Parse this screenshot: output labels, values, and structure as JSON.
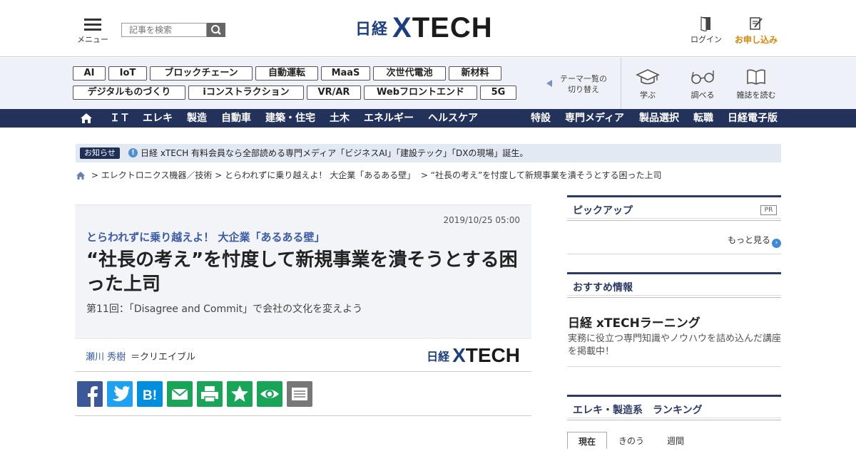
{
  "header": {
    "menu_label": "メニュー",
    "search_placeholder": "記事を検索",
    "logo_nikkei": "日経",
    "logo_x": "X",
    "logo_tech": "TECH",
    "login_label": "ログイン",
    "subscribe_label": "お申し込み"
  },
  "themes": {
    "tags": [
      "AI",
      "IoT",
      "ブロックチェーン",
      "自動運転",
      "MaaS",
      "次世代電池",
      "新材料",
      "デジタルものづくり",
      "iコンストラクション",
      "VR/AR",
      "Webフロントエンド",
      "5G"
    ],
    "switch_line1": "テーマ一覧の",
    "switch_line2": "切り替え",
    "learn_label": "学ぶ",
    "research_label": "調べる",
    "magazine_label": "雑誌を読む"
  },
  "nav": {
    "left": [
      "ＩＴ",
      "エレキ",
      "製造",
      "自動車",
      "建築・住宅",
      "土木",
      "エネルギー",
      "ヘルスケア"
    ],
    "right": [
      "特設",
      "専門メディア",
      "製品選択",
      "転職",
      "日経電子版"
    ]
  },
  "notice": {
    "badge": "お知らせ",
    "text": "日経 xTECH 有料会員なら全部読める専門メディア「ビジネスAI」「建設テック」「DXの現場」誕生。"
  },
  "breadcrumb": [
    "エレクトロニクス機器／技術",
    "とらわれずに乗り越えよ！ 大企業「あるある壁」",
    "“社長の考え”を忖度して新規事業を潰そうとする困った上司"
  ],
  "article": {
    "date": "2019/10/25 05:00",
    "series": "とらわれずに乗り越えよ！ 大企業「あるある壁」",
    "title": "“社長の考え”を忖度して新規事業を潰そうとする困った上司",
    "subtitle": "第11回：「Disagree and Commit」で会社の文化を変えよう",
    "author": "瀬川 秀樹",
    "org": "＝クリエイブル"
  },
  "share": {
    "colors": [
      "#3b5998",
      "#1da1f2",
      "#008fde",
      "#18a558",
      "#18a558",
      "#18a558",
      "#18a558",
      "#777777"
    ],
    "icons": [
      "facebook-icon",
      "twitter-icon",
      "hatena-bookmark-icon",
      "mail-icon",
      "print-icon",
      "clip-icon",
      "watch-icon",
      "memo-icon"
    ]
  },
  "sidebar": {
    "pickup_title": "ピックアップ",
    "pr_label": "PR",
    "more_label": "もっと見る",
    "recommend_title": "おすすめ情報",
    "learning_title": "日経 xTECHラーニング",
    "learning_desc": "実務に役立つ専門知識やノウハウを詰め込んだ講座を掲載中！",
    "ranking_title": "エレキ・製造系　ランキング",
    "ranking_tabs": [
      "現在",
      "きのう",
      "週間"
    ]
  }
}
